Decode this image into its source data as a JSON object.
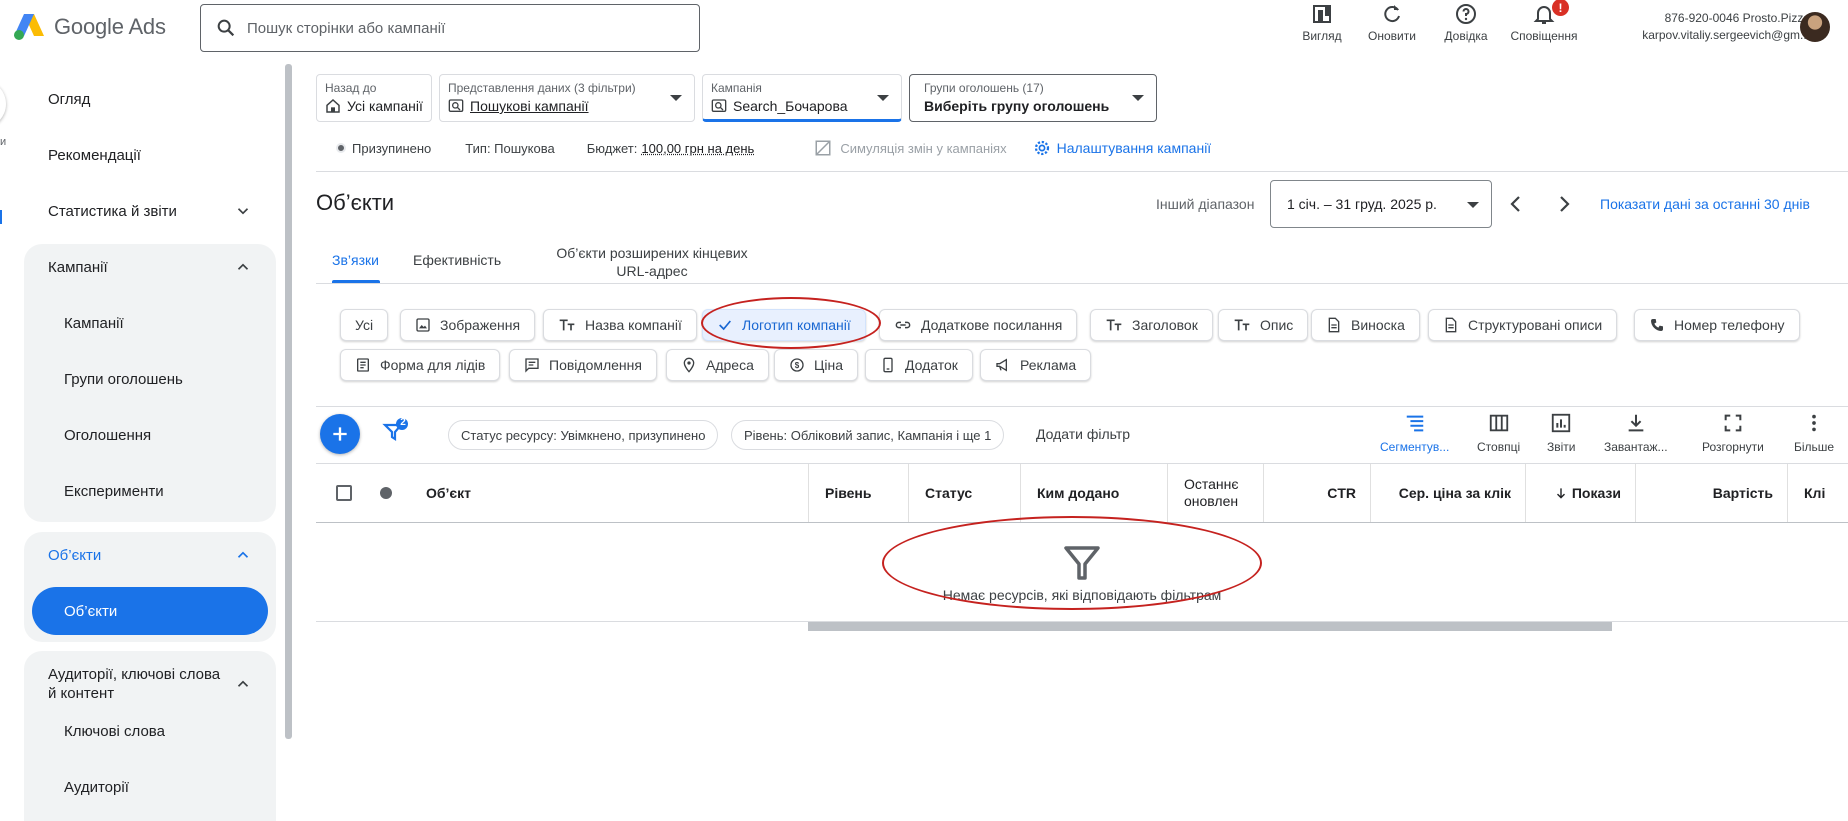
{
  "header": {
    "logo_text": "Google Ads",
    "search_placeholder": "Пошук сторінки або кампанії",
    "actions": [
      {
        "icon": "appearance-icon",
        "label": "Вигляд"
      },
      {
        "icon": "refresh-icon",
        "label": "Оновити"
      },
      {
        "icon": "help-icon",
        "label": "Довідка"
      },
      {
        "icon": "bell-icon",
        "label": "Сповіщення",
        "badge": "!"
      }
    ],
    "account_line1": "876-920-0046 Prosto.Pizza",
    "account_line2": "karpov.vitaliy.sergeevich@gm..."
  },
  "left_rail": {
    "fragment": "и"
  },
  "sidebar": {
    "overview": "Огляд",
    "recommendations": "Рекомендації",
    "stats": "Статистика й звіти",
    "campaigns_section": "Кампанії",
    "campaigns": "Кампанії",
    "ad_groups": "Групи оголошень",
    "ads": "Оголошення",
    "experiments": "Експерименти",
    "assets_section": "Об’єкти",
    "assets_active": "Об’єкти",
    "audiences_section": "Аудиторії, ключові слова й контент",
    "keywords": "Ключові слова",
    "audiences": "Аудиторії"
  },
  "filters": {
    "back_caption": "Назад до",
    "back_value": "Усі кампанії",
    "view_caption": "Представлення даних (3 фільтри)",
    "view_value": "Пошукові кампанії",
    "campaign_caption": "Кампанія",
    "campaign_value": "Search_Бочарова",
    "adgroup_caption": "Групи оголошень (17)",
    "adgroup_value": "Виберіть групу оголошень"
  },
  "status_bar": {
    "status": "Призупинено",
    "type": "Тип: Пошукова",
    "budget_label": "Бюджет:",
    "budget_value": "100,00 грн на день",
    "simulate": "Симуляція змін у кампаніях",
    "settings": "Налаштування кампанії"
  },
  "page": {
    "title": "Об’єкти",
    "range_label": "Інший діапазон",
    "date_range": "1 січ. – 31 груд. 2025 р.",
    "last30": "Показати дані за останні 30 днів"
  },
  "tabs": [
    {
      "label": "Зв’язки",
      "active": true
    },
    {
      "label": "Ефективність",
      "active": false
    },
    {
      "label": "Об’єкти розширених кінцевих URL-адрес",
      "active": false
    }
  ],
  "chips": {
    "all": "Усі",
    "images": "Зображення",
    "business_name": "Назва компанії",
    "logo": "Логотип компанії",
    "sitelink": "Додаткове посилання",
    "headline": "Заголовок",
    "description": "Опис",
    "callout": "Виноска",
    "structured": "Структуровані описи",
    "phone": "Номер телефону",
    "lead_form": "Форма для лідів",
    "message": "Повідомлення",
    "address": "Адреса",
    "price": "Ціна",
    "app": "Додаток",
    "promotion": "Реклама"
  },
  "table_toolbar": {
    "filter_count": "2",
    "filter_status": "Статус ресурсу: Увімкнено, призупинено",
    "filter_level": "Рівень: Обліковий запис, Кампанія і ще 1",
    "add_filter": "Додати фільтр",
    "segment": "Сегментув...",
    "columns": "Стовпці",
    "reports": "Звіти",
    "download": "Завантаж...",
    "expand": "Розгорнути",
    "more": "Більше"
  },
  "table": {
    "columns": [
      "Об’єкт",
      "Рівень",
      "Статус",
      "Ким додано",
      "Останнє оновлен",
      "CTR",
      "Сер. ціна за клік",
      "Покази",
      "Вартість",
      "Клі"
    ],
    "empty_message": "Немає ресурсів, які відповідають фільтрам"
  },
  "colors": {
    "accent": "#1a73e8",
    "annotation": "#c5221f",
    "danger": "#d93025"
  }
}
